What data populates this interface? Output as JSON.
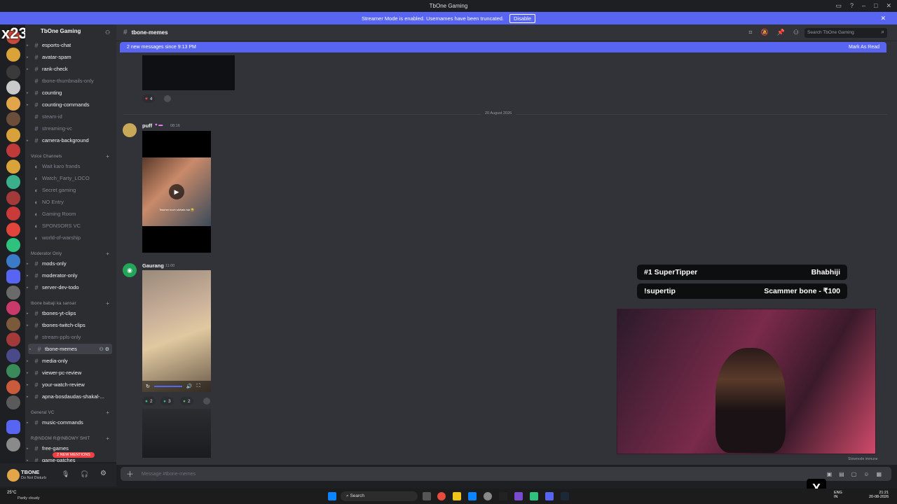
{
  "window": {
    "title": "TbOne Gaming"
  },
  "streamer_banner": {
    "text": "Streamer Mode is enabled. Usernames have been truncated.",
    "button": "Disable"
  },
  "server": {
    "name": "TbOne Gaming"
  },
  "channel_header": {
    "name": "tbone-memes",
    "search_placeholder": "Search TbOne Gaming"
  },
  "new_messages": {
    "text": "2 new messages since 9:13 PM",
    "action": "Mark As Read"
  },
  "categories": {
    "voice": "Voice Channels",
    "mod": "Moderator Only",
    "tbone": "tbone babaji ka sansar",
    "general_vc": "General VC",
    "random": "R@NDOM R@INBOWY SHIT"
  },
  "channels": [
    {
      "label": "esports-chat",
      "muted": false
    },
    {
      "label": "avatar-spam",
      "muted": false
    },
    {
      "label": "rank-check",
      "muted": false
    },
    {
      "label": "tbone-thumbnails-only",
      "muted": true
    },
    {
      "label": "counting",
      "muted": false
    },
    {
      "label": "counting-commands",
      "muted": false
    },
    {
      "label": "steam-id",
      "muted": true
    },
    {
      "label": "streaming-vc",
      "muted": true
    },
    {
      "label": "camera-background",
      "muted": false
    }
  ],
  "voice_channels": [
    "Wait karo frands",
    "Watch_Farty_LOCO",
    "Secret gaming",
    "NO Entry",
    "Gaming Room",
    "SPONSORS VC",
    "world-of-warship"
  ],
  "mod_channels": [
    "mods-only",
    "moderator-only",
    "server-dev-todo"
  ],
  "tbone_channels": [
    "tbones-yt-clips",
    "tbones-twitch-clips",
    "stream-ppls-only",
    "tbone-memes",
    "media-only",
    "viewer-pc-review",
    "your-watch-review",
    "apna-bosdaudas-shakal-..."
  ],
  "general_channels": [
    "music-commands"
  ],
  "random_channels": [
    "free-games",
    "game-patches"
  ],
  "mentions_pill": "2 NEW MENTIONS",
  "user": {
    "name": "TBONE",
    "status": "Do Not Disturb"
  },
  "messages": {
    "top_reaction_count": "4",
    "date_divider": "20 August 2026",
    "msg1": {
      "author": "puff",
      "time": "08:16"
    },
    "msg2": {
      "author": "Gaurang",
      "time": "11:00"
    },
    "reactions": [
      "2",
      "3",
      "2"
    ],
    "video_caption": "Teacher kuch sikhata hai 😂"
  },
  "overlay": {
    "row1_left": "#1 SuperTipper",
    "row1_right": "Bhabhiji",
    "row2_left": "!supertip",
    "row2_right": "Scammer bone - ₹100"
  },
  "webcam_label": "Slowmode immune",
  "composer": {
    "placeholder": "Message #tbone-memes"
  },
  "taskbar": {
    "weather_temp": "25°C",
    "weather_desc": "Partly cloudy",
    "search": "Search",
    "lang1": "ENG",
    "lang2": "IN",
    "time": "21:21",
    "date": "20-08-2026"
  },
  "stream_tag": "x23",
  "colors": {
    "blurple": "#5865f2",
    "bg": "#313338",
    "sidebar": "#2b2d31"
  }
}
